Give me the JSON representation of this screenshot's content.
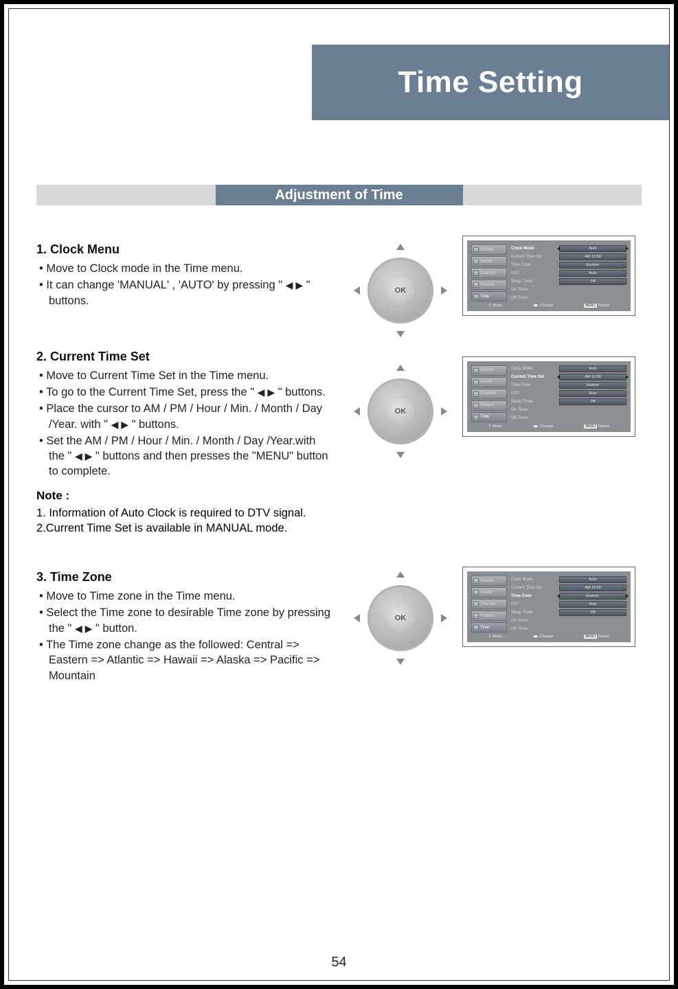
{
  "page_number": "54",
  "title": "Time Setting",
  "subtitle": "Adjustment of Time",
  "dpad_ok": "OK",
  "sections": {
    "s1": {
      "heading": "1. Clock Menu",
      "b1": "Move to Clock mode in the Time menu.",
      "b2a": "It can change 'MANUAL' , 'AUTO' by pressing \" ",
      "b2b": " \" buttons."
    },
    "s2": {
      "heading": "2. Current Time Set",
      "b1": "Move to Current Time Set in the Time menu.",
      "b2a": "To go to the Current Time Set, press the \" ",
      "b2b": " \" buttons.",
      "b3a": "Place the cursor to AM / PM / Hour / Min. / Month / Day /Year. with \" ",
      "b3b": " \" buttons.",
      "b4a": "Set the AM / PM / Hour / Min. / Month / Day /Year.with the \" ",
      "b4b": " \" buttons and then presses the \"MENU\" button to complete.",
      "note_h": "Note :",
      "note1": "1. Information of Auto Clock is required to DTV signal.",
      "note2": "2.Current Time Set is available in MANUAL mode."
    },
    "s3": {
      "heading": "3. Time Zone",
      "b1": "Move to Time zone in the Time menu.",
      "b2a": "Select the Time zone to desirable Time zone by pressing the \" ",
      "b2b": " \" button.",
      "b3": "The Time zone change as the followed: Central => Eastern => Atlantic => Hawaii => Alaska => Pacific => Mountain"
    }
  },
  "osd": {
    "side": {
      "picture": "Picture",
      "sound": "Sound",
      "channel": "Channel",
      "feature": "Feature",
      "time": "Time"
    },
    "rows": {
      "clock_mode": "Clock Mode",
      "current_time_set": "Current Time Set",
      "time_zone": "Time Zone",
      "dst": "DST",
      "sleep_timer": "Sleep Timer",
      "on_timer": "On Timer",
      "off_timer": "Off Timer"
    },
    "vals": {
      "auto": "Auto",
      "am1200": "AM 12:00",
      "eastern": "Eastern",
      "off": "Off"
    },
    "foot": {
      "move": "Move",
      "change": "Change",
      "return": "Return",
      "menu": "MENU"
    }
  }
}
